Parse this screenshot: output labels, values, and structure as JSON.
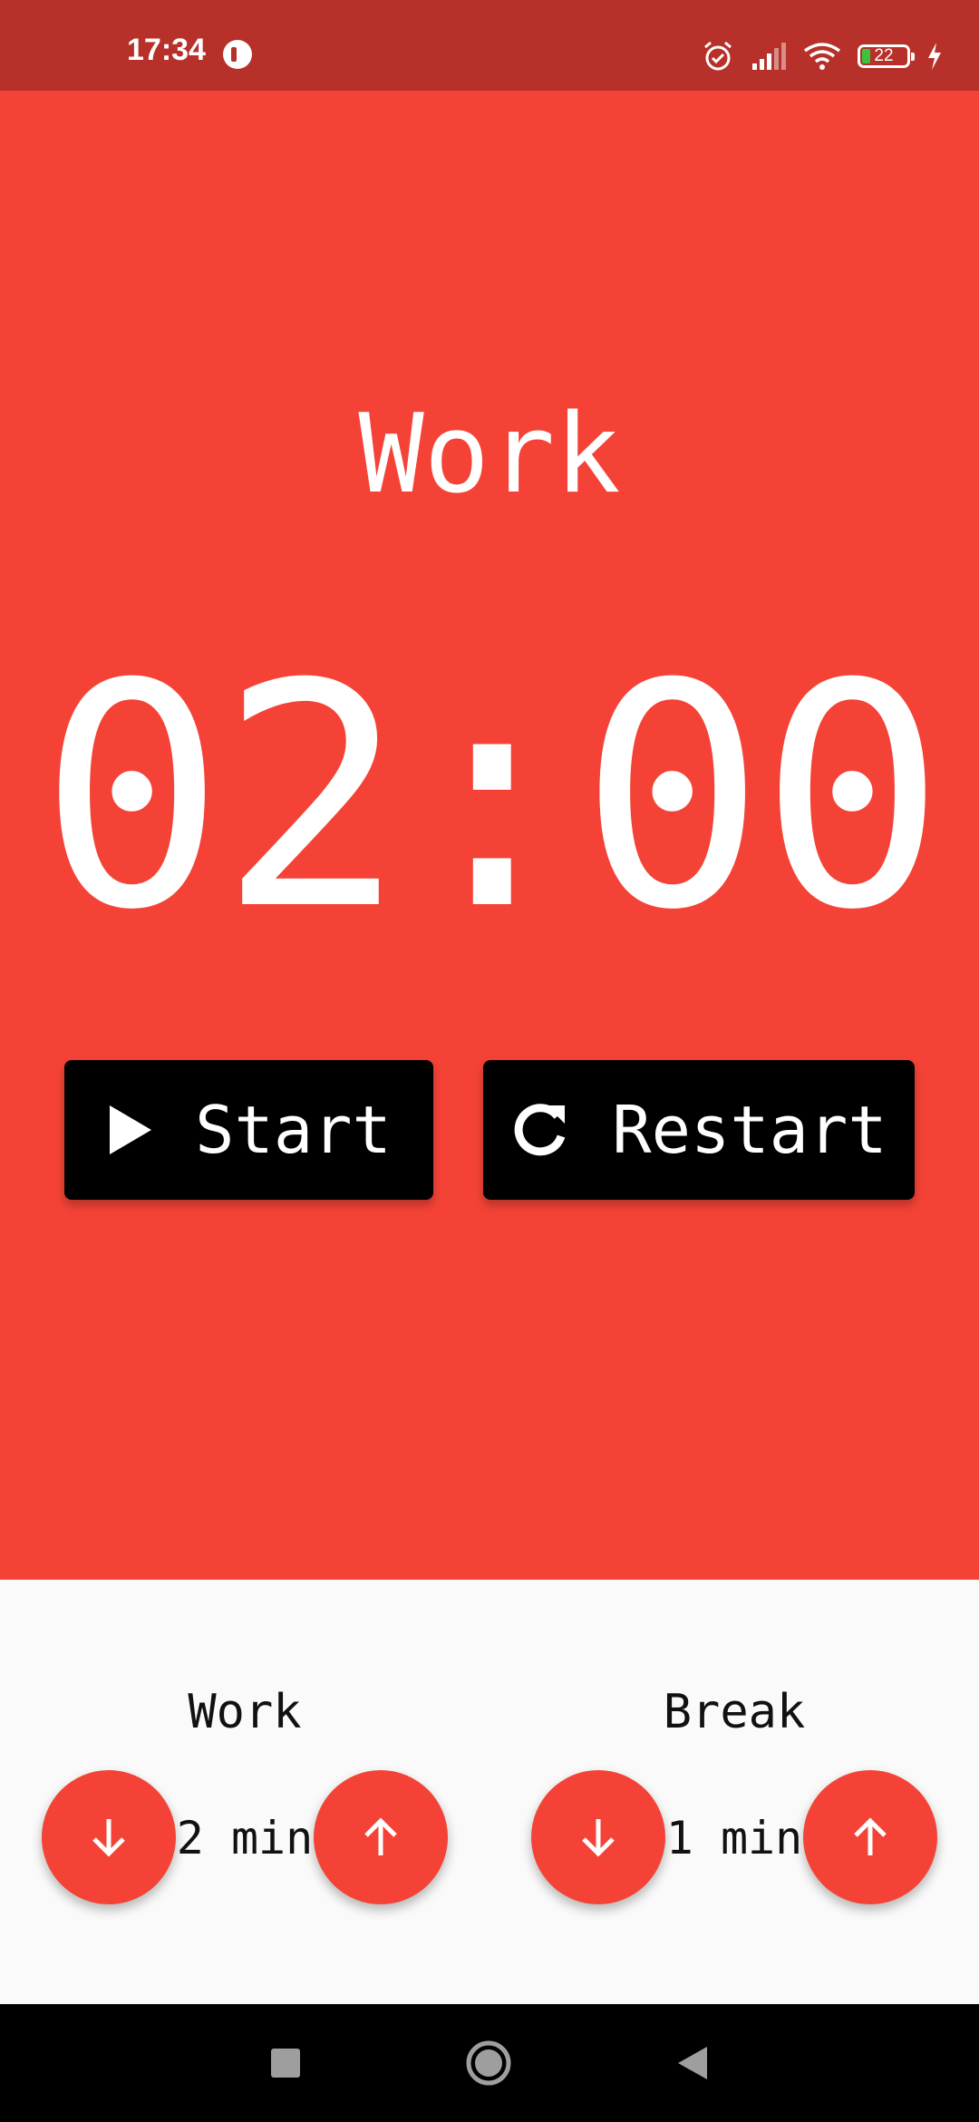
{
  "status_bar": {
    "time": "17:34",
    "battery_level": "22",
    "icons": [
      "app-notification-icon",
      "alarm-icon",
      "signal-icon",
      "wifi-icon",
      "battery-icon",
      "charging-icon"
    ]
  },
  "timer": {
    "mode_title": "Work",
    "time_display": "02:00",
    "start_label": "Start",
    "restart_label": "Restart"
  },
  "settings": {
    "work": {
      "label": "Work",
      "value": "2 min"
    },
    "break": {
      "label": "Break",
      "value": "1 min"
    }
  },
  "colors": {
    "primary": "#f44336",
    "status_bar": "#b7302a",
    "button": "#000000",
    "settings_background": "#fafafa",
    "nav_bar": "#000000"
  },
  "nav_bar": {
    "icons": [
      "recents-icon",
      "home-icon",
      "back-icon"
    ]
  }
}
